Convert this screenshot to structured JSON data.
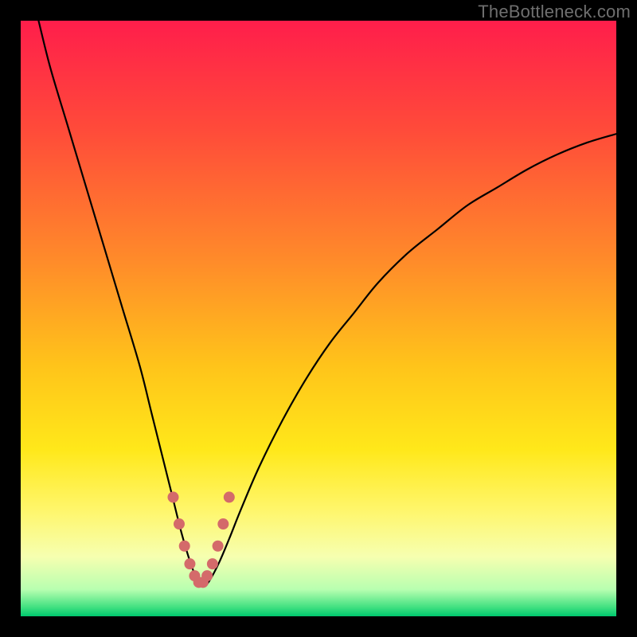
{
  "watermark": "TheBottleneck.com",
  "chart_data": {
    "type": "line",
    "title": "",
    "xlabel": "",
    "ylabel": "",
    "xlim": [
      0,
      100
    ],
    "ylim": [
      0,
      100
    ],
    "grid": false,
    "series": [
      {
        "name": "bottleneck-curve",
        "x": [
          3,
          5,
          8,
          11,
          14,
          17,
          20,
          22,
          24,
          25.5,
          27,
          28.5,
          29.7,
          30.7,
          31.7,
          33.3,
          35,
          37,
          40,
          44,
          48,
          52,
          56,
          60,
          65,
          70,
          75,
          80,
          85,
          90,
          95,
          100
        ],
        "y": [
          100,
          92,
          82,
          72,
          62,
          52,
          42,
          34,
          26,
          20,
          14,
          9,
          6,
          5,
          6,
          9,
          13,
          18,
          25,
          33,
          40,
          46,
          51,
          56,
          61,
          65,
          69,
          72,
          75,
          77.5,
          79.5,
          81
        ]
      }
    ],
    "highlight": {
      "name": "trough-dots",
      "color": "#d46a6a",
      "x": [
        25.6,
        26.6,
        27.5,
        28.4,
        29.2,
        29.9,
        30.6,
        31.3,
        32.2,
        33.1,
        34.0,
        35.0
      ],
      "y": [
        20.0,
        15.5,
        11.8,
        8.8,
        6.8,
        5.7,
        5.7,
        6.8,
        8.8,
        11.8,
        15.5,
        20.0
      ]
    },
    "gradient_stops": [
      {
        "offset": 0.0,
        "color": "#ff1e4b"
      },
      {
        "offset": 0.18,
        "color": "#ff4a3a"
      },
      {
        "offset": 0.4,
        "color": "#ff8a2a"
      },
      {
        "offset": 0.58,
        "color": "#ffc41a"
      },
      {
        "offset": 0.72,
        "color": "#ffe81a"
      },
      {
        "offset": 0.82,
        "color": "#fff66a"
      },
      {
        "offset": 0.9,
        "color": "#f6ffb0"
      },
      {
        "offset": 0.955,
        "color": "#b8ffb0"
      },
      {
        "offset": 0.985,
        "color": "#40e080"
      },
      {
        "offset": 1.0,
        "color": "#00c86e"
      }
    ]
  }
}
